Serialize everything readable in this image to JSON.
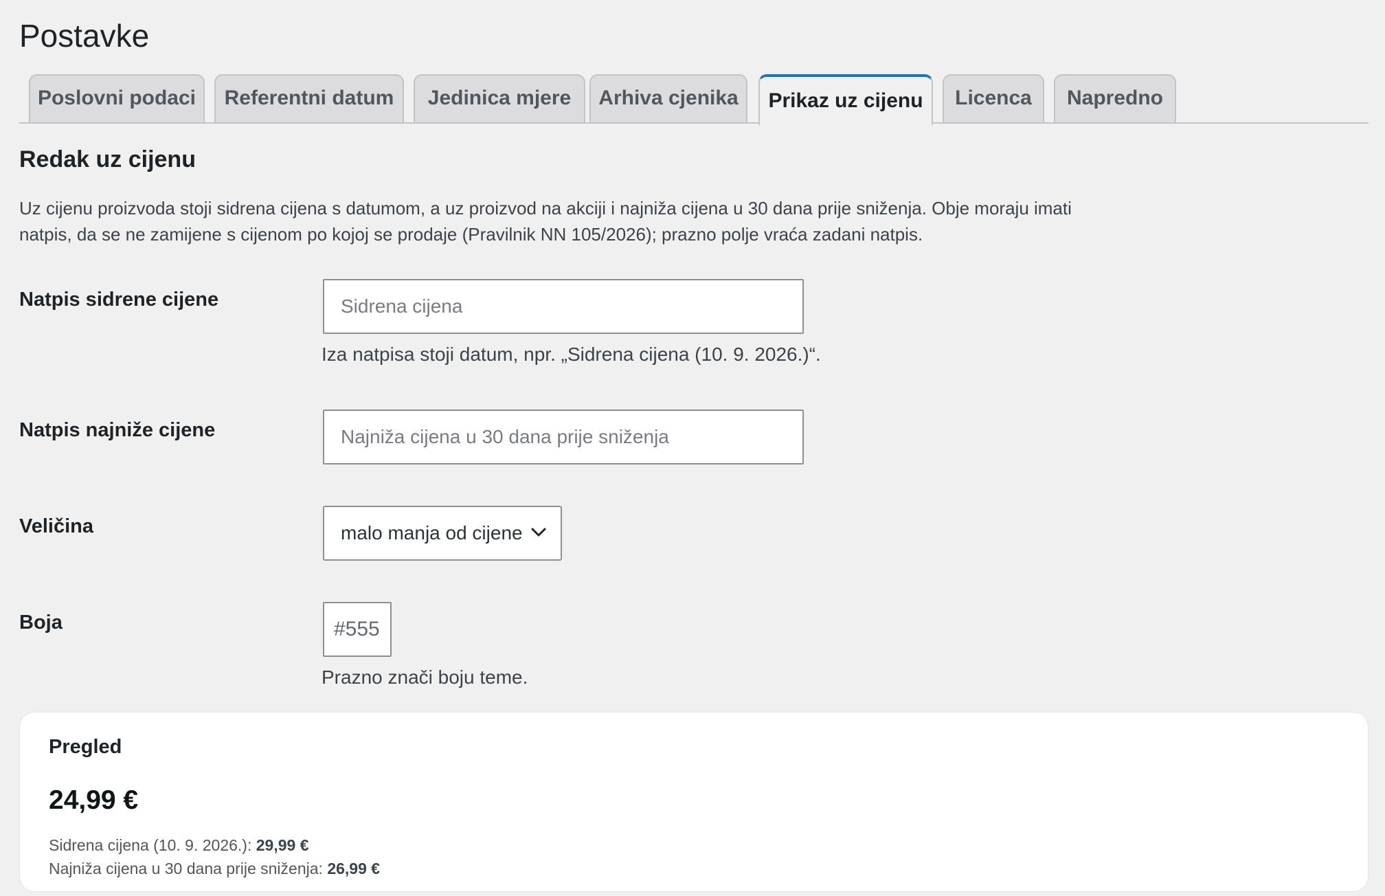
{
  "page": {
    "title": "Postavke"
  },
  "tabs": [
    {
      "label": "Poslovni podaci",
      "active": false
    },
    {
      "label": "Referentni datum",
      "active": false
    },
    {
      "label": "Jedinica mjere",
      "active": false
    },
    {
      "label": "Arhiva cjenika",
      "active": false
    },
    {
      "label": "Prikaz uz cijenu",
      "active": true
    },
    {
      "label": "Licenca",
      "active": false
    },
    {
      "label": "Napredno",
      "active": false
    }
  ],
  "section": {
    "title": "Redak uz cijenu",
    "intro_line1": "Uz cijenu proizvoda stoji sidrena cijena s datumom, a uz proizvod na akciji i najniža cijena u 30 dana prije sniženja. Obje moraju imati",
    "intro_line2": "natpis, da se ne zamijene s cijenom po kojoj se prodaje (Pravilnik NN 105/2026); prazno polje vraća zadani natpis."
  },
  "fields": {
    "anchor_label": {
      "label": "Natpis sidrene cijene",
      "value": "",
      "placeholder": "Sidrena cijena",
      "help": "Iza natpisa stoji datum, npr. „Sidrena cijena (10. 9. 2026.)“."
    },
    "lowest_label": {
      "label": "Natpis najniže cijene",
      "value": "",
      "placeholder": "Najniža cijena u 30 dana prije sniženja"
    },
    "size": {
      "label": "Veličina",
      "selected": "malo manja od cijene"
    },
    "color": {
      "label": "Boja",
      "value": "",
      "placeholder": "#555",
      "help": "Prazno znači boju teme."
    }
  },
  "preview": {
    "title": "Pregled",
    "price": "24,99 €",
    "anchor_text": "Sidrena cijena (10. 9. 2026.):",
    "anchor_value": "29,99 €",
    "lowest_text": "Najniža cijena u 30 dana prije sniženja:",
    "lowest_value": "26,99 €"
  },
  "colors": {
    "accent": "#2271b1",
    "background": "#f0f0f1",
    "preview_text": "#555555"
  }
}
